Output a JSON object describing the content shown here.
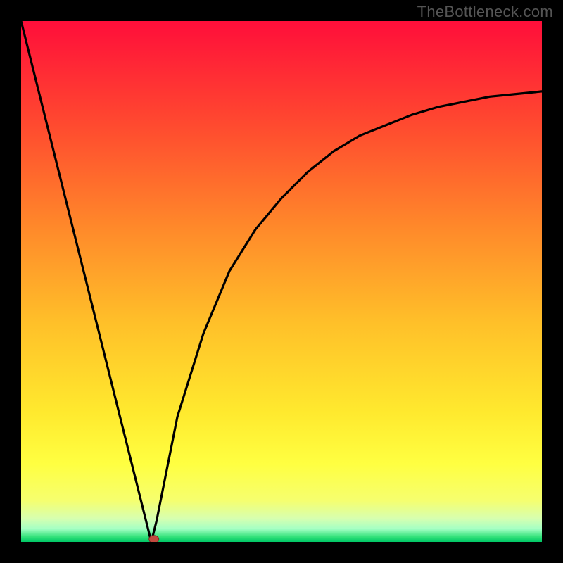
{
  "watermark": "TheBottleneck.com",
  "chart_data": {
    "type": "line",
    "title": "",
    "xlabel": "",
    "ylabel": "",
    "xlim": [
      0,
      100
    ],
    "ylim": [
      0,
      100
    ],
    "series": [
      {
        "name": "curve",
        "x": [
          0,
          5,
          10,
          15,
          20,
          22,
          24,
          25,
          26,
          28,
          30,
          35,
          40,
          45,
          50,
          55,
          60,
          65,
          70,
          75,
          80,
          85,
          90,
          95,
          100
        ],
        "y": [
          100,
          80,
          60,
          40,
          20,
          12,
          4,
          0,
          4,
          14,
          24,
          40,
          52,
          60,
          66,
          71,
          75,
          78,
          80,
          82,
          83.5,
          84.5,
          85.5,
          86,
          86.5
        ]
      }
    ],
    "marker": {
      "x": 25.5,
      "y": 0.5
    },
    "background_gradient": {
      "stops": [
        {
          "offset": 0.0,
          "color": "#ff0e3a"
        },
        {
          "offset": 0.2,
          "color": "#ff4a2f"
        },
        {
          "offset": 0.4,
          "color": "#ff8a2a"
        },
        {
          "offset": 0.58,
          "color": "#ffc029"
        },
        {
          "offset": 0.75,
          "color": "#ffe92e"
        },
        {
          "offset": 0.85,
          "color": "#ffff41"
        },
        {
          "offset": 0.92,
          "color": "#f6ff6e"
        },
        {
          "offset": 0.955,
          "color": "#d7ffb0"
        },
        {
          "offset": 0.975,
          "color": "#a4ffc4"
        },
        {
          "offset": 0.99,
          "color": "#35e27b"
        },
        {
          "offset": 1.0,
          "color": "#00c765"
        }
      ]
    }
  }
}
